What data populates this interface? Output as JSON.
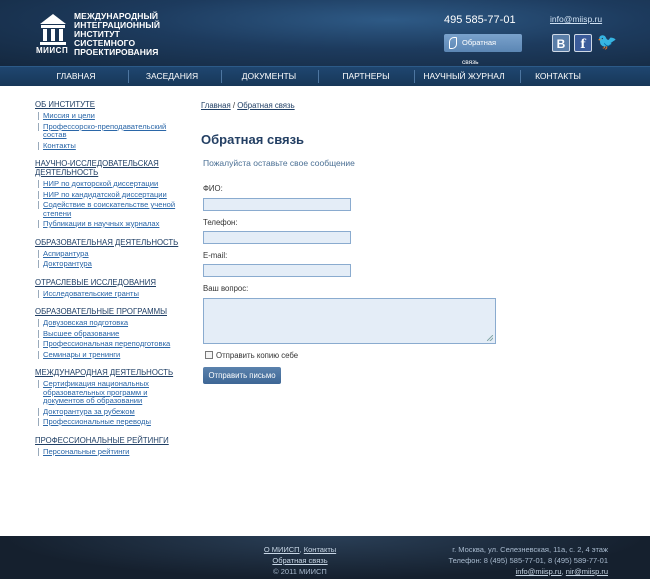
{
  "header": {
    "logo_abbr": "МИИСП",
    "logo_lines": [
      "МЕЖДУНАРОДНЫЙ",
      "ИНТЕГРАЦИОННЫЙ",
      "ИНСТИТУТ",
      "СИСТЕМНОГО",
      "ПРОЕКТИРОВАНИЯ"
    ],
    "phone": "495 585-77-01",
    "email": "info@miisp.ru",
    "callback_label": "Обратная",
    "callback_sub": "связь",
    "vk_label": "В",
    "fb_label": "f",
    "twitter_label": "🐦"
  },
  "nav": [
    "ГЛАВНАЯ",
    "ЗАСЕДАНИЯ",
    "ДОКУМЕНТЫ",
    "ПАРТНЕРЫ",
    "НАУЧНЫЙ ЖУРНАЛ",
    "КОНТАКТЫ"
  ],
  "sidebar": [
    {
      "title": "ОБ ИНСТИТУТЕ",
      "items": [
        "Миссия и цели",
        "Профессорско-преподавательский состав",
        "Контакты"
      ]
    },
    {
      "title": "НАУЧНО-ИССЛЕДОВАТЕЛЬСКАЯ ДЕЯТЕЛЬНОСТЬ",
      "items": [
        "НИР по докторской диссертации",
        "НИР по кандидатской диссертации",
        "Содействие в соискательстве ученой степени",
        "Публикации в научных журналах"
      ]
    },
    {
      "title": "ОБРАЗОВАТЕЛЬНАЯ ДЕЯТЕЛЬНОСТЬ",
      "items": [
        "Аспирантура",
        "Докторантура"
      ]
    },
    {
      "title": "ОТРАСЛЕВЫЕ ИССЛЕДОВАНИЯ",
      "items": [
        "Исследовательские гранты"
      ]
    },
    {
      "title": "ОБРАЗОВАТЕЛЬНЫЕ ПРОГРАММЫ",
      "items": [
        "Довузовская подготовка",
        "Высшее образование",
        "Профессиональная переподготовка",
        "Семинары и тренинги"
      ]
    },
    {
      "title": "МЕЖДУНАРОДНАЯ ДЕЯТЕЛЬНОСТЬ",
      "items": [
        "Сертификация национальных образовательных программ и документов об образовании",
        "Докторантура за рубежом",
        "Профессиональные переводы"
      ]
    },
    {
      "title": "ПРОФЕССИОНАЛЬНЫЕ РЕЙТИНГИ",
      "items": [
        "Персональные рейтинги"
      ]
    }
  ],
  "breadcrumb": {
    "home": "Главная",
    "sep": "/",
    "current": "Обратная связь"
  },
  "main": {
    "title": "Обратная связь",
    "subtitle": "Пожалуйста оставьте свое сообщение",
    "fio_label": "ФИО:",
    "phone_label": "Телефон:",
    "email_label": "E-mail:",
    "question_label": "Ваш вопрос:",
    "copy_label": "Отправить копию себе",
    "submit_label": "Отправить письмо"
  },
  "footer": {
    "about": "О МИИСП",
    "comma": ",",
    "contacts": "Контакты",
    "feedback": "Обратная связь",
    "copyright": "© 2011 МИИСП",
    "address": "г. Москва, ул. Селезневская, 11а, с. 2, 4 этаж",
    "phones": "Телефон: 8 (495) 585-77-01, 8 (495) 589-77-01",
    "email1": "info@miisp.ru",
    "email2": "nir@miisp.ru"
  }
}
